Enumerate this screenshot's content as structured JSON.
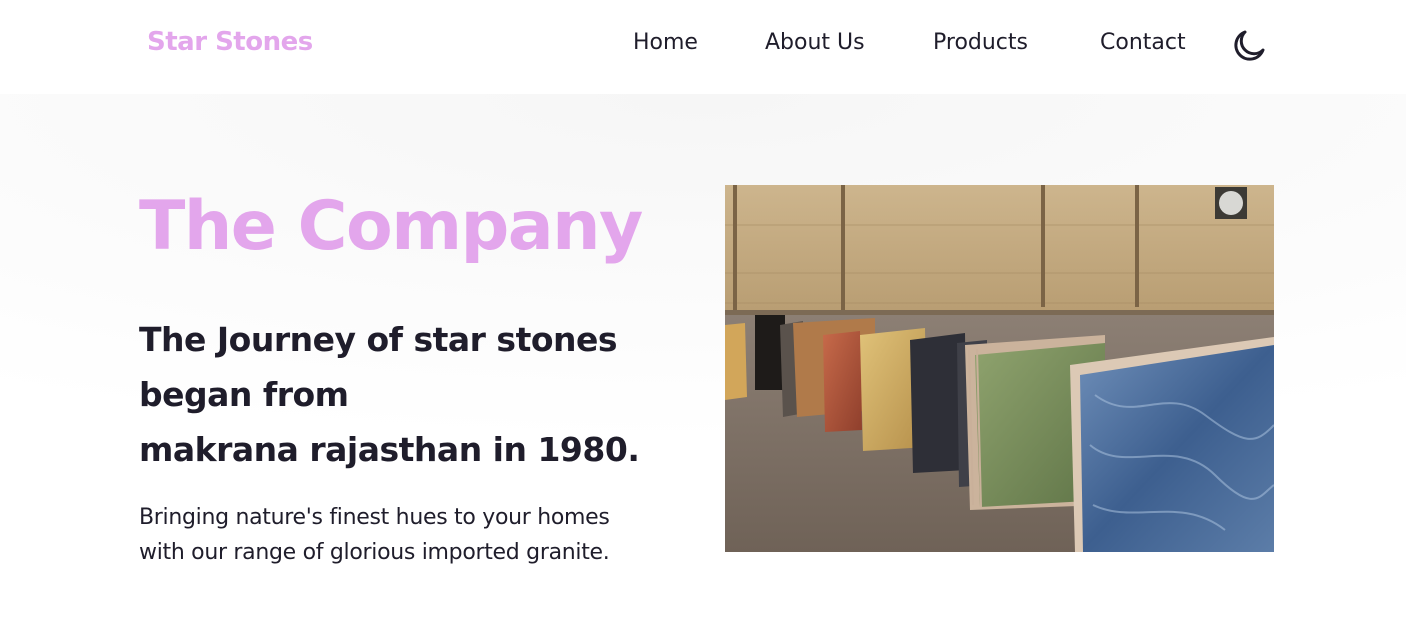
{
  "nav": {
    "brand": "Star Stones",
    "links": [
      "Home",
      "About Us",
      "Products",
      "Contact"
    ],
    "theme_icon": "moon-icon"
  },
  "hero": {
    "title": "The Company",
    "heading_lines": [
      "The Journey of star stones",
      "began from",
      "makrana rajasthan in 1980."
    ],
    "text_lines": [
      "Bringing nature's finest hues to your homes",
      "with our range of glorious imported granite."
    ],
    "image": "granite-slab-warehouse-photo"
  },
  "colors": {
    "accent": "#e3a6ec",
    "text": "#1f1d2b",
    "background": "#ffffff"
  }
}
